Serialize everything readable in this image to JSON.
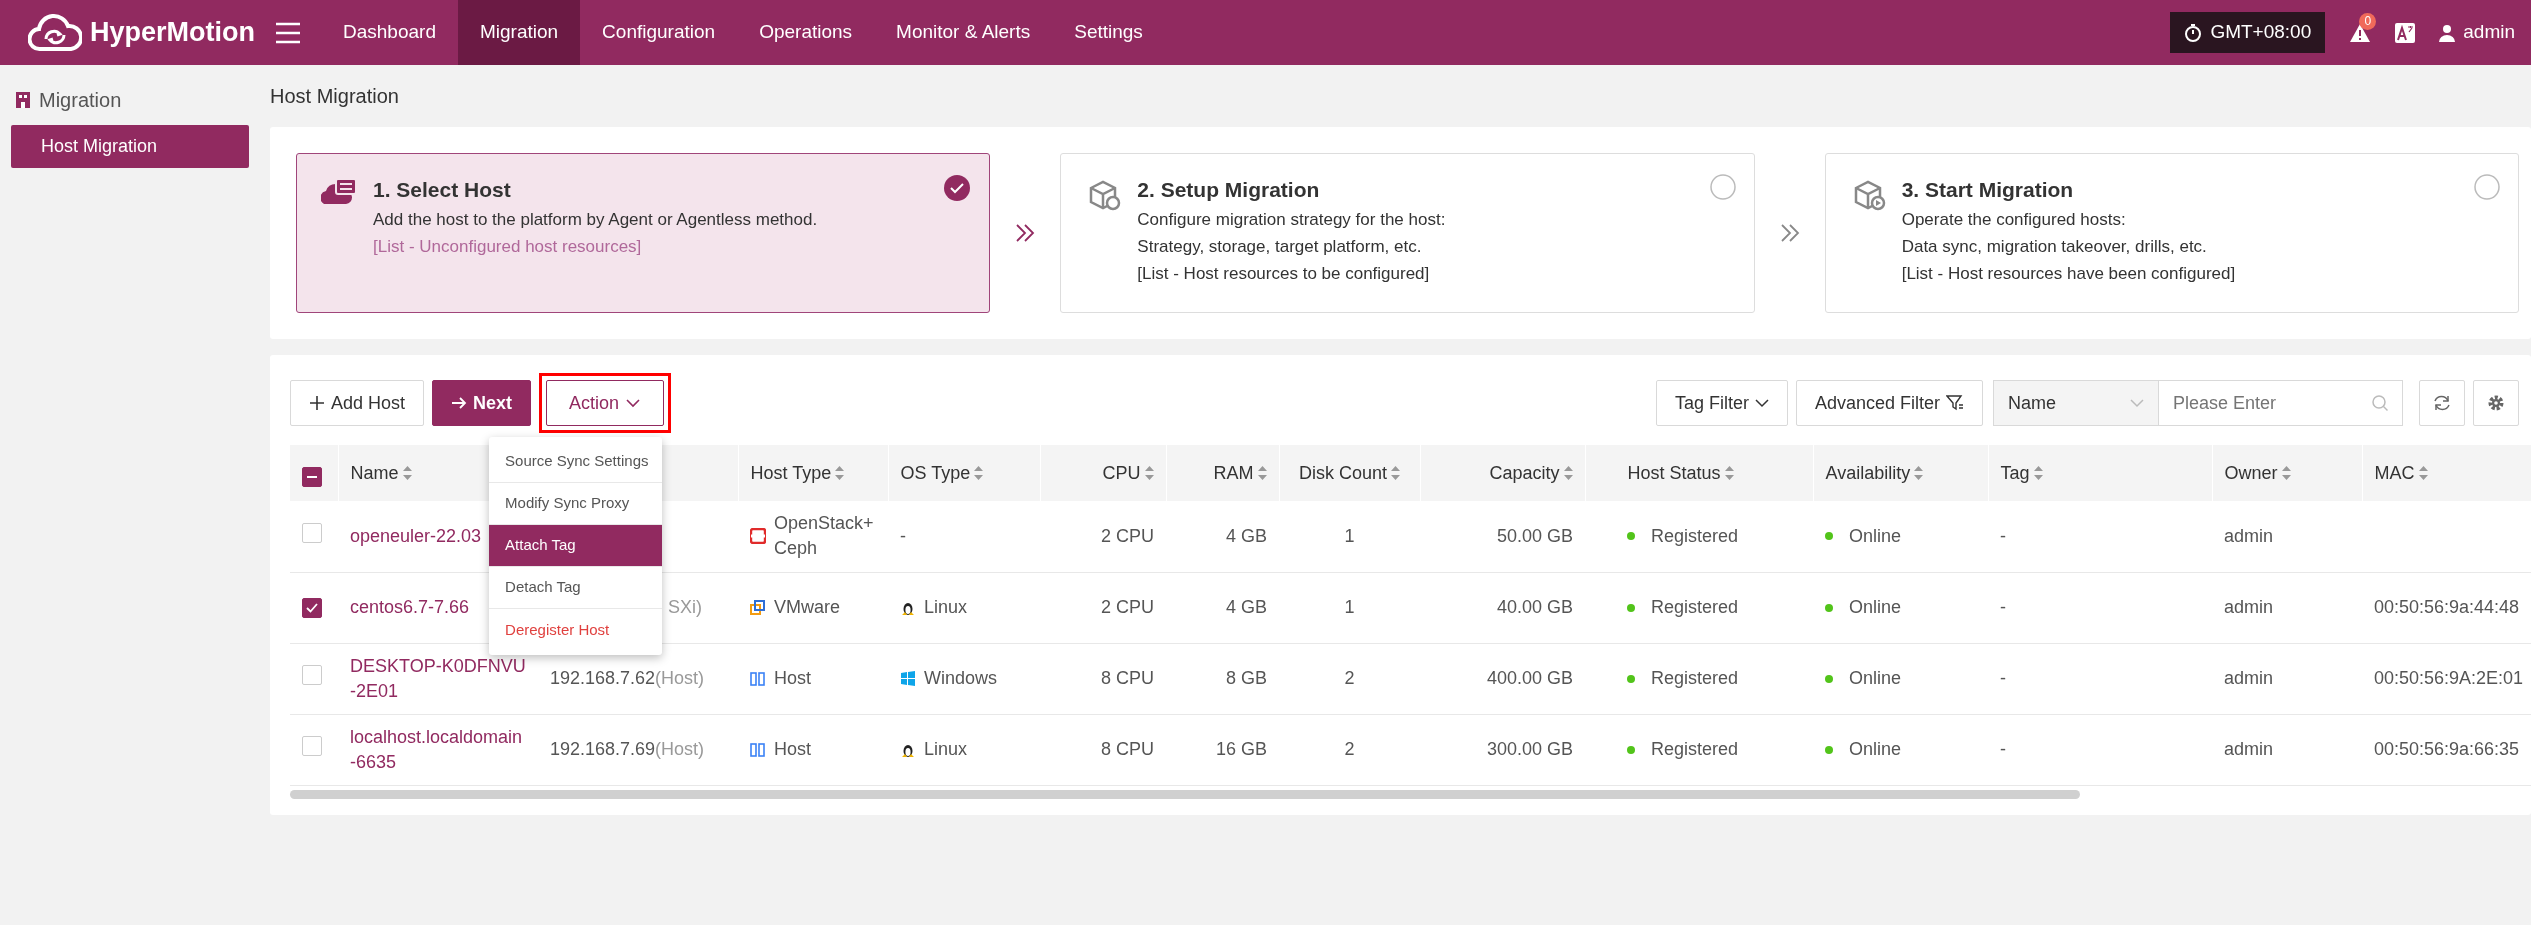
{
  "brand": "HyperMotion",
  "nav": [
    {
      "label": "Dashboard",
      "selected": false
    },
    {
      "label": "Migration",
      "selected": true
    },
    {
      "label": "Configuration",
      "selected": false
    },
    {
      "label": "Operations",
      "selected": false
    },
    {
      "label": "Monitor & Alerts",
      "selected": false
    },
    {
      "label": "Settings",
      "selected": false
    }
  ],
  "header": {
    "timezone": "GMT+08:00",
    "alert_count": "0",
    "user": "admin"
  },
  "sidebar": {
    "title": "Migration",
    "items": [
      {
        "label": "Host Migration",
        "selected": true
      }
    ]
  },
  "page_title": "Host Migration",
  "steps": [
    {
      "title": "1. Select Host",
      "lines": [
        "Add the host to the platform by Agent or Agentless method.",
        "[List - Unconfigured host resources]"
      ],
      "selected": true,
      "done": true
    },
    {
      "title": "2. Setup Migration",
      "lines": [
        "Configure migration strategy for the host:",
        "Strategy, storage, target platform, etc.",
        "[List - Host resources to be configured]"
      ],
      "selected": false,
      "done": false
    },
    {
      "title": "3. Start Migration",
      "lines": [
        "Operate the configured hosts:",
        "Data sync, migration takeover, drills, etc.",
        "[List - Host resources have been configured]"
      ],
      "selected": false,
      "done": false
    }
  ],
  "buttons": [
    {
      "label": "Add Host",
      "kind": "add",
      "highlighted": false
    },
    {
      "label": "Next",
      "kind": "next",
      "highlighted": false
    },
    {
      "label": "Action",
      "kind": "action",
      "highlighted": true
    }
  ],
  "menu": [
    {
      "label": "Source Sync Settings",
      "kind": "normal",
      "selected": false
    },
    {
      "label": "Modify Sync Proxy",
      "kind": "normal",
      "selected": false
    },
    {
      "label": "Attach Tag",
      "kind": "normal",
      "selected": true
    },
    {
      "label": "Detach Tag",
      "kind": "normal",
      "selected": false
    },
    {
      "label": "Deregister Host",
      "kind": "danger",
      "selected": false
    }
  ],
  "filters": {
    "tag_filter": "Tag Filter",
    "advanced_filter": "Advanced Filter",
    "field": "Name",
    "search_placeholder": "Please Enter"
  },
  "table": {
    "header_checkbox": {
      "indeterminate": true
    },
    "columns": [
      "Name",
      "Host Type",
      "OS Type",
      "CPU",
      "RAM",
      "Disk Count",
      "Capacity",
      "Host Status",
      "Availability",
      "Tag",
      "Owner",
      "MAC"
    ],
    "rows": [
      {
        "checked": false,
        "name": "openeuler-22.03",
        "host_type": {
          "label": "OpenStack+ Ceph",
          "kind": "openstack"
        },
        "os_type": {
          "label": "-"
        },
        "cpu": "2 CPU",
        "ram": "4 GB",
        "disks": "1",
        "capacity": "50.00 GB",
        "host_status": {
          "label": "Registered",
          "color": "#52c41a"
        },
        "availability": {
          "label": "Online",
          "color": "#52c41a"
        },
        "tag": "-",
        "owner": "admin"
      },
      {
        "checked": true,
        "name": "centos6.7-7.66",
        "address": {
          "note": "SXi)"
        },
        "host_type": {
          "label": "VMware",
          "kind": "vmware"
        },
        "os_type": {
          "label": "Linux",
          "kind": "linux"
        },
        "cpu": "2 CPU",
        "ram": "4 GB",
        "disks": "1",
        "capacity": "40.00 GB",
        "host_status": {
          "label": "Registered",
          "color": "#52c41a"
        },
        "availability": {
          "label": "Online",
          "color": "#52c41a"
        },
        "tag": "-",
        "owner": "admin",
        "mac": "00:50:56:9a:44:48"
      },
      {
        "checked": false,
        "name": "DESKTOP-K0DFNVU-2E01",
        "address": {
          "ip": "192.168.7.62",
          "note": "(Host)"
        },
        "host_type": {
          "label": "Host",
          "kind": "host"
        },
        "os_type": {
          "label": "Windows",
          "kind": "windows"
        },
        "cpu": "8 CPU",
        "ram": "8 GB",
        "disks": "2",
        "capacity": "400.00 GB",
        "host_status": {
          "label": "Registered",
          "color": "#52c41a"
        },
        "availability": {
          "label": "Online",
          "color": "#52c41a"
        },
        "tag": "-",
        "owner": "admin",
        "mac": "00:50:56:9A:2E:01"
      },
      {
        "checked": false,
        "name": "localhost.localdomain-6635",
        "address": {
          "ip": "192.168.7.69",
          "note": "(Host)"
        },
        "host_type": {
          "label": "Host",
          "kind": "host"
        },
        "os_type": {
          "label": "Linux",
          "kind": "linux"
        },
        "cpu": "8 CPU",
        "ram": "16 GB",
        "disks": "2",
        "capacity": "300.00 GB",
        "host_status": {
          "label": "Registered",
          "color": "#52c41a"
        },
        "availability": {
          "label": "Online",
          "color": "#52c41a"
        },
        "tag": "-",
        "owner": "admin",
        "mac": "00:50:56:9a:66:35"
      }
    ]
  }
}
